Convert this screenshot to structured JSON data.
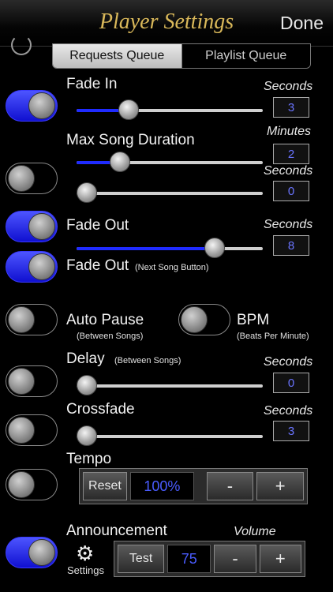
{
  "nav": {
    "title": "Player Settings",
    "done_label": "Done"
  },
  "tabs": [
    {
      "label": "Requests Queue",
      "selected": true
    },
    {
      "label": "Playlist Queue",
      "selected": false
    }
  ],
  "settings": {
    "fade_in": {
      "label": "Fade In",
      "unit": "Seconds",
      "value": "3",
      "toggle_on": true,
      "slider_fraction": 0.25
    },
    "max_song_duration": {
      "label": "Max Song Duration",
      "unit1": "Minutes",
      "value1": "2",
      "slider1_fraction": 0.2,
      "unit2": "Seconds",
      "value2": "0",
      "slider2_fraction": 0.0,
      "toggle_on": false
    },
    "fade_out": {
      "label": "Fade Out",
      "unit": "Seconds",
      "value": "8",
      "toggle_on": true,
      "slider_fraction": 0.77
    },
    "fade_out_next": {
      "label": "Fade Out",
      "sub": "(Next Song Button)",
      "toggle_on": true
    },
    "auto_pause": {
      "label": "Auto Pause",
      "sub": "(Between Songs)",
      "toggle_on": false
    },
    "bpm": {
      "label": "BPM",
      "sub": "(Beats Per Minute)",
      "toggle_on": false
    },
    "delay": {
      "label": "Delay",
      "sub": "(Between Songs)",
      "unit": "Seconds",
      "value": "0",
      "toggle_on": false,
      "slider_fraction": 0.0
    },
    "crossfade": {
      "label": "Crossfade",
      "unit": "Seconds",
      "value": "3",
      "toggle_on": false,
      "slider_fraction": 0.0
    },
    "tempo": {
      "label": "Tempo",
      "reset_label": "Reset",
      "value": "100%",
      "minus_label": "-",
      "plus_label": "+",
      "toggle_on": false
    },
    "announcement": {
      "label": "Announcement",
      "volume_label": "Volume",
      "settings_label": "Settings",
      "test_label": "Test",
      "value": "75",
      "minus_label": "-",
      "plus_label": "+",
      "toggle_on": true
    }
  }
}
